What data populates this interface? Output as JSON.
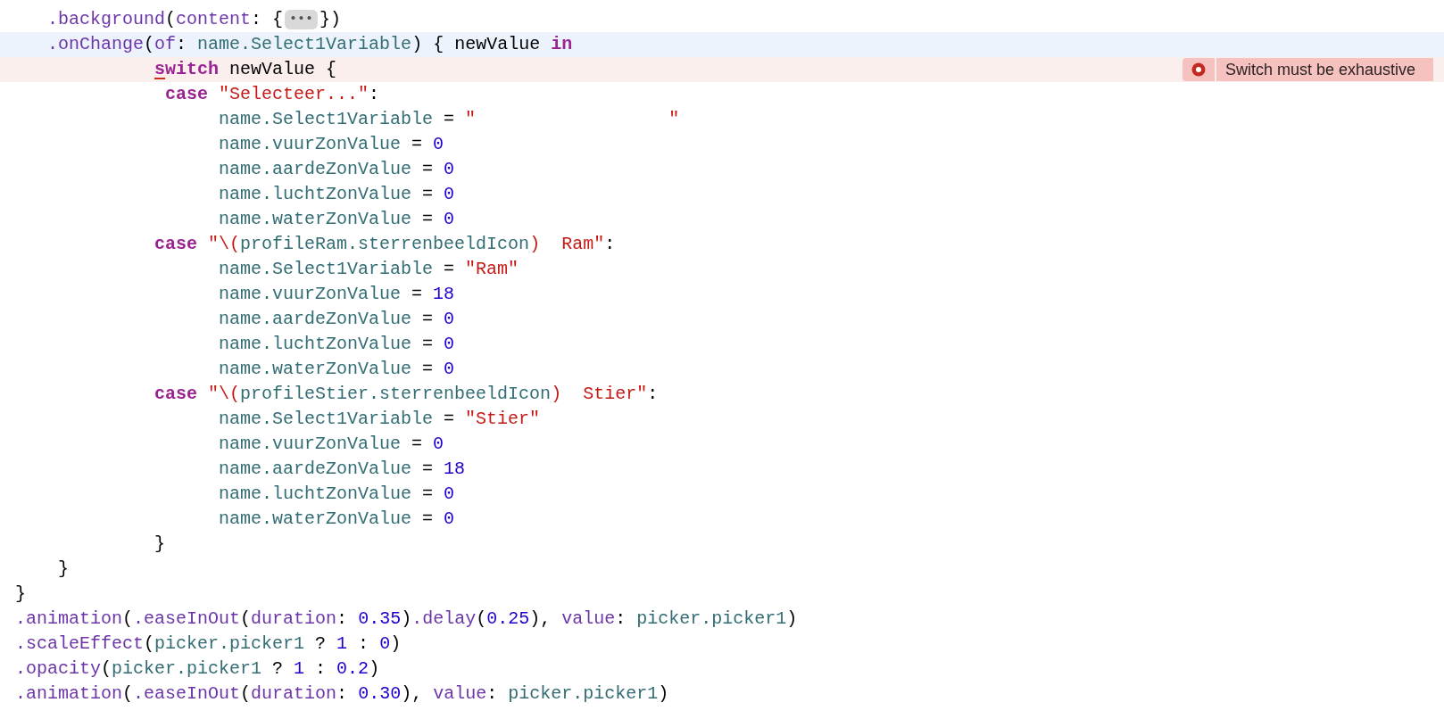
{
  "editor": {
    "lines": [
      {
        "current": false,
        "error": false,
        "tokens": [
          {
            "text": "   .background",
            "kind": "method"
          },
          {
            "text": "(",
            "kind": "plain"
          },
          {
            "text": "content",
            "kind": "method"
          },
          {
            "text": ": {",
            "kind": "plain"
          },
          {
            "text": "•••",
            "kind": "fold"
          },
          {
            "text": "})",
            "kind": "plain"
          }
        ]
      },
      {
        "current": true,
        "error": false,
        "tokens": [
          {
            "text": "   .onChange",
            "kind": "method"
          },
          {
            "text": "(",
            "kind": "plain"
          },
          {
            "text": "of",
            "kind": "method"
          },
          {
            "text": ": ",
            "kind": "plain"
          },
          {
            "text": "name.Select1Variable",
            "kind": "prop"
          },
          {
            "text": ") { newValue ",
            "kind": "plain"
          },
          {
            "text": "in",
            "kind": "keyword"
          }
        ]
      },
      {
        "current": false,
        "error": true,
        "error_message": "Switch must be exhaustive",
        "tokens": [
          {
            "text": "             s",
            "kind": "error_keyword"
          },
          {
            "text": "witch",
            "kind": "keyword"
          },
          {
            "text": " newValue {",
            "kind": "plain"
          }
        ]
      },
      {
        "current": false,
        "error": false,
        "tokens": [
          {
            "text": "              case ",
            "kind": "keyword"
          },
          {
            "text": "\"Selecteer...\"",
            "kind": "string"
          },
          {
            "text": ":",
            "kind": "plain"
          }
        ]
      },
      {
        "current": false,
        "error": false,
        "tokens": [
          {
            "text": "                   name.Select1Variable",
            "kind": "prop"
          },
          {
            "text": " = ",
            "kind": "plain"
          },
          {
            "text": "\"                  \"",
            "kind": "string"
          }
        ]
      },
      {
        "current": false,
        "error": false,
        "tokens": [
          {
            "text": "                   name.vuurZonValue",
            "kind": "prop"
          },
          {
            "text": " = ",
            "kind": "plain"
          },
          {
            "text": "0",
            "kind": "number"
          }
        ]
      },
      {
        "current": false,
        "error": false,
        "tokens": [
          {
            "text": "                   name.aardeZonValue",
            "kind": "prop"
          },
          {
            "text": " = ",
            "kind": "plain"
          },
          {
            "text": "0",
            "kind": "number"
          }
        ]
      },
      {
        "current": false,
        "error": false,
        "tokens": [
          {
            "text": "                   name.luchtZonValue",
            "kind": "prop"
          },
          {
            "text": " = ",
            "kind": "plain"
          },
          {
            "text": "0",
            "kind": "number"
          }
        ]
      },
      {
        "current": false,
        "error": false,
        "tokens": [
          {
            "text": "                   name.waterZonValue",
            "kind": "prop"
          },
          {
            "text": " = ",
            "kind": "plain"
          },
          {
            "text": "0",
            "kind": "number"
          }
        ]
      },
      {
        "current": false,
        "error": false,
        "tokens": [
          {
            "text": "             case ",
            "kind": "keyword"
          },
          {
            "text": "\"\\(",
            "kind": "string"
          },
          {
            "text": "profileRam.sterrenbeeldIcon",
            "kind": "prop"
          },
          {
            "text": ")  Ram\"",
            "kind": "string"
          },
          {
            "text": ":",
            "kind": "plain"
          }
        ]
      },
      {
        "current": false,
        "error": false,
        "tokens": [
          {
            "text": "                   name.Select1Variable",
            "kind": "prop"
          },
          {
            "text": " = ",
            "kind": "plain"
          },
          {
            "text": "\"Ram\"",
            "kind": "string"
          }
        ]
      },
      {
        "current": false,
        "error": false,
        "tokens": [
          {
            "text": "                   name.vuurZonValue",
            "kind": "prop"
          },
          {
            "text": " = ",
            "kind": "plain"
          },
          {
            "text": "18",
            "kind": "number"
          }
        ]
      },
      {
        "current": false,
        "error": false,
        "tokens": [
          {
            "text": "                   name.aardeZonValue",
            "kind": "prop"
          },
          {
            "text": " = ",
            "kind": "plain"
          },
          {
            "text": "0",
            "kind": "number"
          }
        ]
      },
      {
        "current": false,
        "error": false,
        "tokens": [
          {
            "text": "                   name.luchtZonValue",
            "kind": "prop"
          },
          {
            "text": " = ",
            "kind": "plain"
          },
          {
            "text": "0",
            "kind": "number"
          }
        ]
      },
      {
        "current": false,
        "error": false,
        "tokens": [
          {
            "text": "                   name.waterZonValue",
            "kind": "prop"
          },
          {
            "text": " = ",
            "kind": "plain"
          },
          {
            "text": "0",
            "kind": "number"
          }
        ]
      },
      {
        "current": false,
        "error": false,
        "tokens": [
          {
            "text": "             case ",
            "kind": "keyword"
          },
          {
            "text": "\"\\(",
            "kind": "string"
          },
          {
            "text": "profileStier.sterrenbeeldIcon",
            "kind": "prop"
          },
          {
            "text": ")  Stier\"",
            "kind": "string"
          },
          {
            "text": ":",
            "kind": "plain"
          }
        ]
      },
      {
        "current": false,
        "error": false,
        "tokens": [
          {
            "text": "                   name.Select1Variable",
            "kind": "prop"
          },
          {
            "text": " = ",
            "kind": "plain"
          },
          {
            "text": "\"Stier\"",
            "kind": "string"
          }
        ]
      },
      {
        "current": false,
        "error": false,
        "tokens": [
          {
            "text": "                   name.vuurZonValue",
            "kind": "prop"
          },
          {
            "text": " = ",
            "kind": "plain"
          },
          {
            "text": "0",
            "kind": "number"
          }
        ]
      },
      {
        "current": false,
        "error": false,
        "tokens": [
          {
            "text": "                   name.aardeZonValue",
            "kind": "prop"
          },
          {
            "text": " = ",
            "kind": "plain"
          },
          {
            "text": "18",
            "kind": "number"
          }
        ]
      },
      {
        "current": false,
        "error": false,
        "tokens": [
          {
            "text": "                   name.luchtZonValue",
            "kind": "prop"
          },
          {
            "text": " = ",
            "kind": "plain"
          },
          {
            "text": "0",
            "kind": "number"
          }
        ]
      },
      {
        "current": false,
        "error": false,
        "tokens": [
          {
            "text": "                   name.waterZonValue",
            "kind": "prop"
          },
          {
            "text": " = ",
            "kind": "plain"
          },
          {
            "text": "0",
            "kind": "number"
          }
        ]
      },
      {
        "current": false,
        "error": false,
        "tokens": [
          {
            "text": "             }",
            "kind": "plain"
          }
        ]
      },
      {
        "current": false,
        "error": false,
        "tokens": [
          {
            "text": "    }",
            "kind": "plain"
          }
        ]
      },
      {
        "current": false,
        "error": false,
        "tokens": [
          {
            "text": "}",
            "kind": "plain"
          }
        ]
      },
      {
        "current": false,
        "error": false,
        "tokens": [
          {
            "text": ".animation",
            "kind": "method"
          },
          {
            "text": "(",
            "kind": "plain"
          },
          {
            "text": ".easeInOut",
            "kind": "method"
          },
          {
            "text": "(",
            "kind": "plain"
          },
          {
            "text": "duration",
            "kind": "method"
          },
          {
            "text": ": ",
            "kind": "plain"
          },
          {
            "text": "0.35",
            "kind": "number"
          },
          {
            "text": ")",
            "kind": "plain"
          },
          {
            "text": ".delay",
            "kind": "method"
          },
          {
            "text": "(",
            "kind": "plain"
          },
          {
            "text": "0.25",
            "kind": "number"
          },
          {
            "text": "), ",
            "kind": "plain"
          },
          {
            "text": "value",
            "kind": "method"
          },
          {
            "text": ": ",
            "kind": "plain"
          },
          {
            "text": "picker.picker1",
            "kind": "prop"
          },
          {
            "text": ")",
            "kind": "plain"
          }
        ]
      },
      {
        "current": false,
        "error": false,
        "tokens": [
          {
            "text": ".scaleEffect",
            "kind": "method"
          },
          {
            "text": "(",
            "kind": "plain"
          },
          {
            "text": "picker.picker1",
            "kind": "prop"
          },
          {
            "text": " ? ",
            "kind": "plain"
          },
          {
            "text": "1",
            "kind": "number"
          },
          {
            "text": " : ",
            "kind": "plain"
          },
          {
            "text": "0",
            "kind": "number"
          },
          {
            "text": ")",
            "kind": "plain"
          }
        ]
      },
      {
        "current": false,
        "error": false,
        "tokens": [
          {
            "text": ".opacity",
            "kind": "method"
          },
          {
            "text": "(",
            "kind": "plain"
          },
          {
            "text": "picker.picker1",
            "kind": "prop"
          },
          {
            "text": " ? ",
            "kind": "plain"
          },
          {
            "text": "1",
            "kind": "number"
          },
          {
            "text": " : ",
            "kind": "plain"
          },
          {
            "text": "0.2",
            "kind": "number"
          },
          {
            "text": ")",
            "kind": "plain"
          }
        ]
      },
      {
        "current": false,
        "error": false,
        "tokens": [
          {
            "text": ".animation",
            "kind": "method"
          },
          {
            "text": "(",
            "kind": "plain"
          },
          {
            "text": ".easeInOut",
            "kind": "method"
          },
          {
            "text": "(",
            "kind": "plain"
          },
          {
            "text": "duration",
            "kind": "method"
          },
          {
            "text": ": ",
            "kind": "plain"
          },
          {
            "text": "0.30",
            "kind": "number"
          },
          {
            "text": "), ",
            "kind": "plain"
          },
          {
            "text": "value",
            "kind": "method"
          },
          {
            "text": ": ",
            "kind": "plain"
          },
          {
            "text": "picker.picker1",
            "kind": "prop"
          },
          {
            "text": ")",
            "kind": "plain"
          }
        ]
      }
    ]
  }
}
